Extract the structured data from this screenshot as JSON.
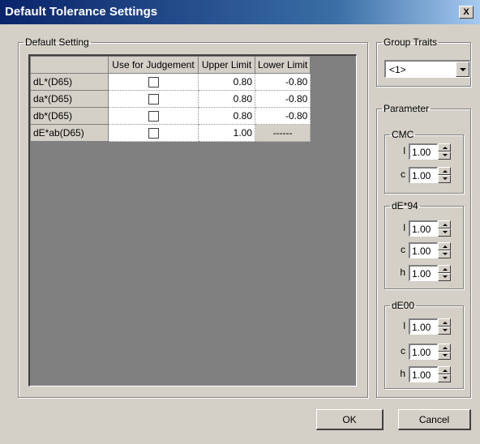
{
  "window": {
    "title": "Default Tolerance Settings",
    "close_label": "X"
  },
  "default_setting": {
    "legend": "Default Setting",
    "columns": [
      "Use for Judgement",
      "Upper Limit",
      "Lower Limit"
    ],
    "rows": [
      {
        "name": "dL*(D65)",
        "use": false,
        "upper": "0.80",
        "lower": "-0.80"
      },
      {
        "name": "da*(D65)",
        "use": false,
        "upper": "0.80",
        "lower": "-0.80"
      },
      {
        "name": "db*(D65)",
        "use": false,
        "upper": "0.80",
        "lower": "-0.80"
      },
      {
        "name": "dE*ab(D65)",
        "use": false,
        "upper": "1.00",
        "lower": "------"
      }
    ]
  },
  "group_traits": {
    "legend": "Group Traits",
    "value": "<1>"
  },
  "parameter": {
    "legend": "Parameter",
    "cmc": {
      "legend": "CMC",
      "l_label": "l",
      "l": "1.00",
      "c_label": "c",
      "c": "1.00"
    },
    "de94": {
      "legend": "dE*94",
      "l_label": "l",
      "l": "1.00",
      "c_label": "c",
      "c": "1.00",
      "h_label": "h",
      "h": "1.00"
    },
    "de00": {
      "legend": "dE00",
      "l_label": "l",
      "l": "1.00",
      "c_label": "c",
      "c": "1.00",
      "h_label": "h",
      "h": "1.00"
    }
  },
  "buttons": {
    "ok": "OK",
    "cancel": "Cancel"
  }
}
